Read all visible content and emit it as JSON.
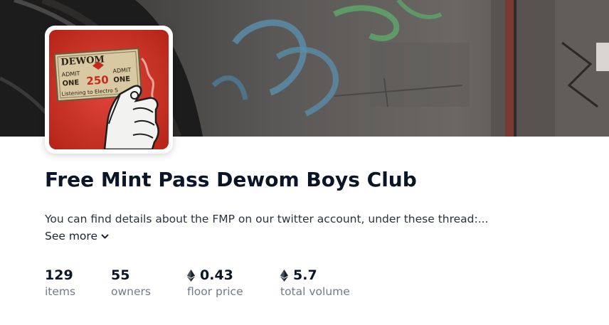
{
  "collection": {
    "title": "Free Mint Pass Dewom Boys Club",
    "description": "You can find details about the FMP on our twitter account, under these thread:...",
    "see_more_label": "See more",
    "avatar": {
      "ticket_text_brand": "DEWOM",
      "ticket_text_admit": "ADMIT",
      "ticket_text_one": "ONE",
      "ticket_text_number": "250",
      "ticket_text_listening": "Listening to Electro S",
      "accent_color": "#d8352a"
    }
  },
  "stats": [
    {
      "value": "129",
      "label": "items",
      "icon": null
    },
    {
      "value": "55",
      "label": "owners",
      "icon": null
    },
    {
      "value": "0.43",
      "label": "floor price",
      "icon": "ethereum-icon"
    },
    {
      "value": "5.7",
      "label": "total volume",
      "icon": "ethereum-icon"
    }
  ],
  "colors": {
    "title": "#0b1528",
    "label": "#727a89",
    "banner_base": "#3c3b3a"
  }
}
